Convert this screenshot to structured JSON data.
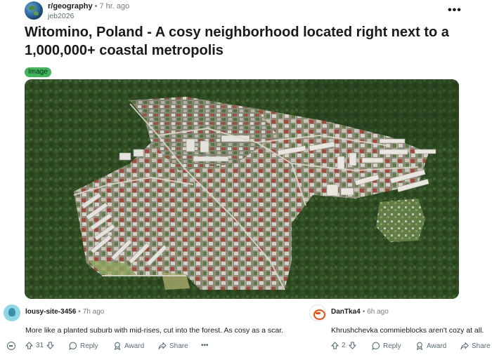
{
  "post": {
    "subreddit": "r/geography",
    "separator": "•",
    "time": "7 hr. ago",
    "user": "jeb2026",
    "more": "•••",
    "title_line1": "Witomino, Poland - A cosy neighborhood located right next to a",
    "title_line2": "1,000,000+ coastal metropolis",
    "flair": "Image",
    "flair_color": "#3db65c"
  },
  "comments": [
    {
      "author": "lousy-site-3456",
      "separator": "•",
      "time": "7h ago",
      "body": "More like a planted suburb with mid-rises, cut into the forest. As cosy as a scar.",
      "score": "31",
      "reply": "Reply",
      "award": "Award",
      "share": "Share",
      "more": "•••"
    },
    {
      "author": "DanTka4",
      "separator": "•",
      "time": "6h ago",
      "body": "Khrushchevka commieblocks aren't cozy at all.",
      "score": "2",
      "reply": "Reply",
      "award": "Award",
      "share": "Share"
    }
  ],
  "colors": {
    "text_primary": "#1a1a1b",
    "text_secondary": "#576f76",
    "meta_gray": "#7c7c7c",
    "forest": "#2f4a23"
  },
  "icons": [
    "subreddit-globe-icon",
    "more-options-icon",
    "collapse-icon",
    "upvote-icon",
    "downvote-icon",
    "reply-icon",
    "award-icon",
    "share-icon",
    "user-avatar-icon"
  ]
}
